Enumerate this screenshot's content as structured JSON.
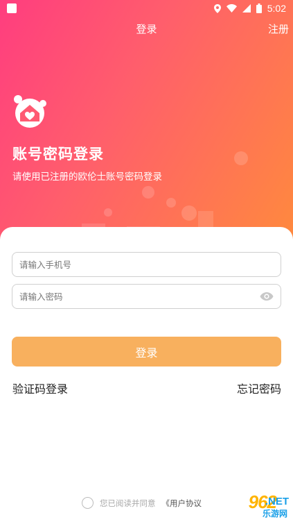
{
  "status_bar": {
    "time": "5:02"
  },
  "nav": {
    "title": "登录",
    "register": "注册"
  },
  "hero": {
    "heading": "账号密码登录",
    "subheading": "请使用已注册的欧伦士账号密码登录"
  },
  "form": {
    "phone_placeholder": "请输入手机号",
    "password_placeholder": "请输入密码",
    "login_label": "登录",
    "sms_login": "验证码登录",
    "forgot_password": "忘记密码"
  },
  "agreement": {
    "text": "您已阅读并同意",
    "link": "《用户协议"
  },
  "watermark": {
    "number": "962",
    "net": ".NET",
    "cn": "乐游网"
  },
  "colors": {
    "gradient_start": "#ff3d7f",
    "gradient_end": "#ff8a3d",
    "button": "#f8b05e"
  },
  "icons": [
    "status-app-icon",
    "location-icon",
    "wifi-icon",
    "signal-icon",
    "battery-icon",
    "logo-house-heart-icon",
    "eye-icon"
  ]
}
